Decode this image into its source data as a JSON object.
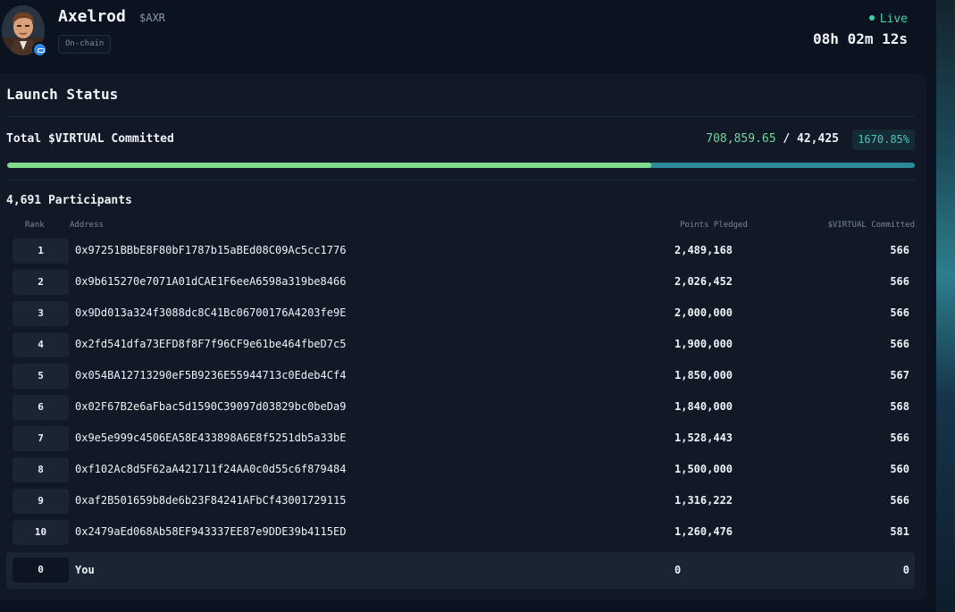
{
  "header": {
    "token_name": "Axelrod",
    "ticker": "$AXR",
    "chip": "On-chain",
    "status": "Live",
    "countdown": "08h 02m 12s",
    "avatar_icon": "avatar-portrait",
    "badge_icon": "verified-badge-icon"
  },
  "launch": {
    "title": "Launch Status",
    "total_label": "Total $VIRTUAL Committed",
    "committed": "708,859.65",
    "separator": "/",
    "target": "42,425",
    "percent": "1670.85%",
    "progress_fraction": 0.71,
    "participants": "4,691 Participants"
  },
  "table": {
    "headers": {
      "rank": "Rank",
      "address": "Address",
      "points": "Points Pledged",
      "committed": "$VIRTUAL Committed"
    },
    "rows": [
      {
        "rank": "1",
        "address": "0x97251BBbE8F80bF1787b15aBEd08C09Ac5cc1776",
        "points": "2,489,168",
        "committed": "566"
      },
      {
        "rank": "2",
        "address": "0x9b615270e7071A01dCAE1F6eeA6598a319be8466",
        "points": "2,026,452",
        "committed": "566"
      },
      {
        "rank": "3",
        "address": "0x9Dd013a324f3088dc8C41Bc06700176A4203fe9E",
        "points": "2,000,000",
        "committed": "566"
      },
      {
        "rank": "4",
        "address": "0x2fd541dfa73EFD8f8F7f96CF9e61be464fbeD7c5",
        "points": "1,900,000",
        "committed": "566"
      },
      {
        "rank": "5",
        "address": "0x054BA12713290eF5B9236E55944713c0Edeb4Cf4",
        "points": "1,850,000",
        "committed": "567"
      },
      {
        "rank": "6",
        "address": "0x02F67B2e6aFbac5d1590C39097d03829bc0beDa9",
        "points": "1,840,000",
        "committed": "568"
      },
      {
        "rank": "7",
        "address": "0x9e5e999c4506EA58E433898A6E8f5251db5a33bE",
        "points": "1,528,443",
        "committed": "566"
      },
      {
        "rank": "8",
        "address": "0xf102Ac8d5F62aA421711f24AA0c0d55c6f879484",
        "points": "1,500,000",
        "committed": "560"
      },
      {
        "rank": "9",
        "address": "0xaf2B501659b8de6b23F84241AFbCf43001729115",
        "points": "1,316,222",
        "committed": "566"
      },
      {
        "rank": "10",
        "address": "0x2479aEd068Ab58EF943337EE87e9DDE39b4115ED",
        "points": "1,260,476",
        "committed": "581"
      }
    ],
    "you": {
      "rank": "0",
      "label": "You",
      "points": "0",
      "committed": "0"
    }
  },
  "colors": {
    "background": "#0b1320",
    "card": "#111926",
    "accent_green": "#76d39b",
    "accent_teal": "#49c6c0",
    "live_green": "#3ed3a6",
    "progress_fill": "#82dc8f",
    "progress_track": "#2d8a9a"
  }
}
